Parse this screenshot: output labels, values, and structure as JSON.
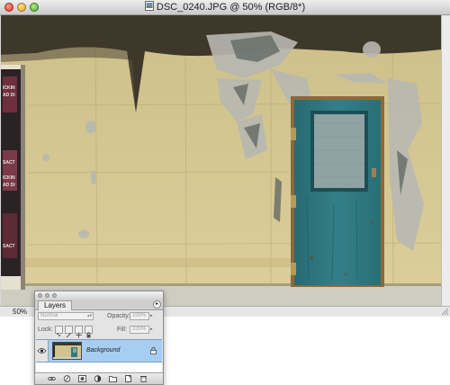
{
  "document": {
    "title": "DSC_0240.JPG @ 50% (RGB/8*)",
    "zoom_level": "50%"
  },
  "icons": {
    "window_buttons": [
      "close-icon",
      "minimize-icon",
      "zoom-icon"
    ],
    "lock_buttons": [
      "lock-transparent-icon",
      "lock-paint-icon",
      "lock-move-icon",
      "lock-all-icon"
    ],
    "footer_buttons": [
      "link-layers-icon",
      "layer-style-icon",
      "layer-mask-icon",
      "adjustment-layer-icon",
      "new-group-icon",
      "new-layer-icon",
      "delete-layer-icon"
    ]
  },
  "layers_panel": {
    "tab_label": "Layers",
    "menu_glyph": "▸",
    "blend_mode": "Normal",
    "opacity_label": "Opacity:",
    "opacity_value": "100%",
    "lock_label": "Lock:",
    "fill_label": "Fill:",
    "fill_value": "100%",
    "layers": [
      {
        "name": "Background",
        "visible": true,
        "locked": true,
        "selected": true
      }
    ]
  },
  "colors": {
    "selected_layer": "#a8cdf2",
    "wall": "#d8cb96",
    "door": "#2f7a82"
  }
}
